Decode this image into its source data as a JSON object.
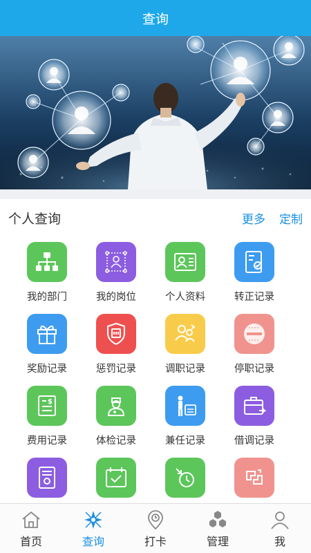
{
  "header": {
    "title": "查询"
  },
  "section": {
    "title": "个人查询",
    "more_label": "更多",
    "custom_label": "定制"
  },
  "tiles": [
    {
      "label": "我的部门",
      "icon": "org-chart-icon",
      "color": "#5cc65a"
    },
    {
      "label": "我的岗位",
      "icon": "position-network-icon",
      "color": "#8c5de0"
    },
    {
      "label": "个人资料",
      "icon": "profile-card-icon",
      "color": "#5cc65a"
    },
    {
      "label": "转正记录",
      "icon": "regularization-doc-icon",
      "color": "#3d9cf0"
    },
    {
      "label": "奖励记录",
      "icon": "gift-box-icon",
      "color": "#3d9cf0"
    },
    {
      "label": "惩罚记录",
      "icon": "penalty-shield-icon",
      "color": "#ee5050"
    },
    {
      "label": "调职记录",
      "icon": "transfer-people-icon",
      "color": "#f8cc4a"
    },
    {
      "label": "停职记录",
      "icon": "suspension-grid-icon",
      "color": "#f0938e"
    },
    {
      "label": "费用记录",
      "icon": "expense-bill-icon",
      "color": "#5cc65a"
    },
    {
      "label": "体检记录",
      "icon": "doctor-icon",
      "color": "#5cc65a"
    },
    {
      "label": "兼任记录",
      "icon": "concurrent-post-icon",
      "color": "#3d9cf0"
    },
    {
      "label": "借调记录",
      "icon": "secondment-briefcase-icon",
      "color": "#8c5de0"
    },
    {
      "label": "",
      "icon": "certificate-icon",
      "color": "#8c5de0"
    },
    {
      "label": "",
      "icon": "calendar-check-icon",
      "color": "#5cc65a"
    },
    {
      "label": "",
      "icon": "clock-arrow-icon",
      "color": "#5cc65a"
    },
    {
      "label": "",
      "icon": "contract-exchange-icon",
      "color": "#f0938e"
    }
  ],
  "tabbar": {
    "items": [
      {
        "label": "首页",
        "icon": "home-icon",
        "active": false
      },
      {
        "label": "查询",
        "icon": "compass-icon",
        "active": true
      },
      {
        "label": "打卡",
        "icon": "location-clock-icon",
        "active": false
      },
      {
        "label": "管理",
        "icon": "hexagons-icon",
        "active": false
      },
      {
        "label": "我",
        "icon": "user-icon",
        "active": false
      }
    ]
  },
  "colors": {
    "header": "#1ea8ea",
    "accent": "#1a8fe0",
    "active_tab": "#1a8fe0",
    "inactive_tab": "#888888"
  }
}
